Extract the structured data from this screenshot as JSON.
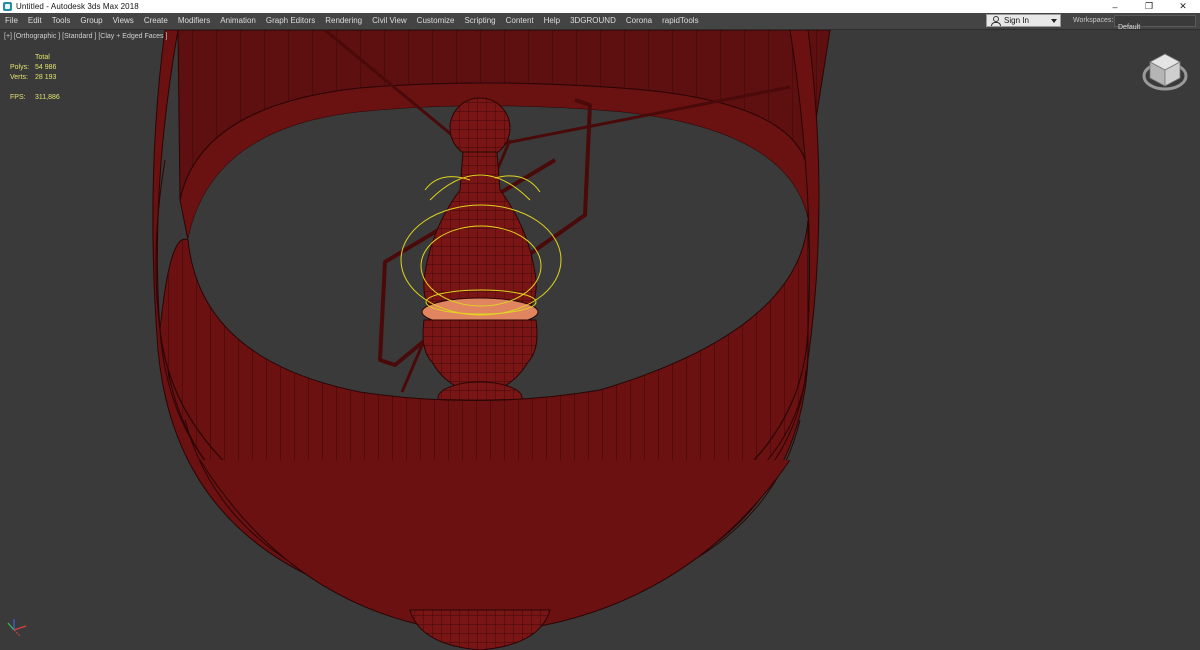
{
  "window": {
    "title": "Untitled - Autodesk 3ds Max 2018",
    "controls": {
      "minimize": "–",
      "restore": "❐",
      "close": "✕"
    }
  },
  "menubar": {
    "items": [
      "File",
      "Edit",
      "Tools",
      "Group",
      "Views",
      "Create",
      "Modifiers",
      "Animation",
      "Graph Editors",
      "Rendering",
      "Civil View",
      "Customize",
      "Scripting",
      "Content",
      "Help",
      "3DGROUND",
      "Corona",
      "rapidTools"
    ]
  },
  "signin": {
    "label": "Sign In"
  },
  "workspaces": {
    "label": "Workspaces:",
    "value": "Default"
  },
  "viewport": {
    "label": "[+] [Orthographic ] [Standard ] [Clay + Edged Faces ]",
    "stats": {
      "total_label": "Total",
      "polys_label": "Polys:",
      "polys_value": "54 986",
      "verts_label": "Verts:",
      "verts_value": "28 193",
      "fps_label": "FPS:",
      "fps_value": "311,886"
    }
  },
  "colors": {
    "model": "#6b1111",
    "model_dark": "#4a0a0a",
    "wire": "#2a0505",
    "highlight": "#d8734f",
    "selection": "#e0d420",
    "viewport_bg": "#3a3a3a",
    "hud_text": "#e3e370"
  },
  "icons": {
    "app": "3ds-max-logo-icon",
    "viewcube": "viewcube-icon",
    "axis": "axis-tripod-icon",
    "user": "user-icon"
  }
}
